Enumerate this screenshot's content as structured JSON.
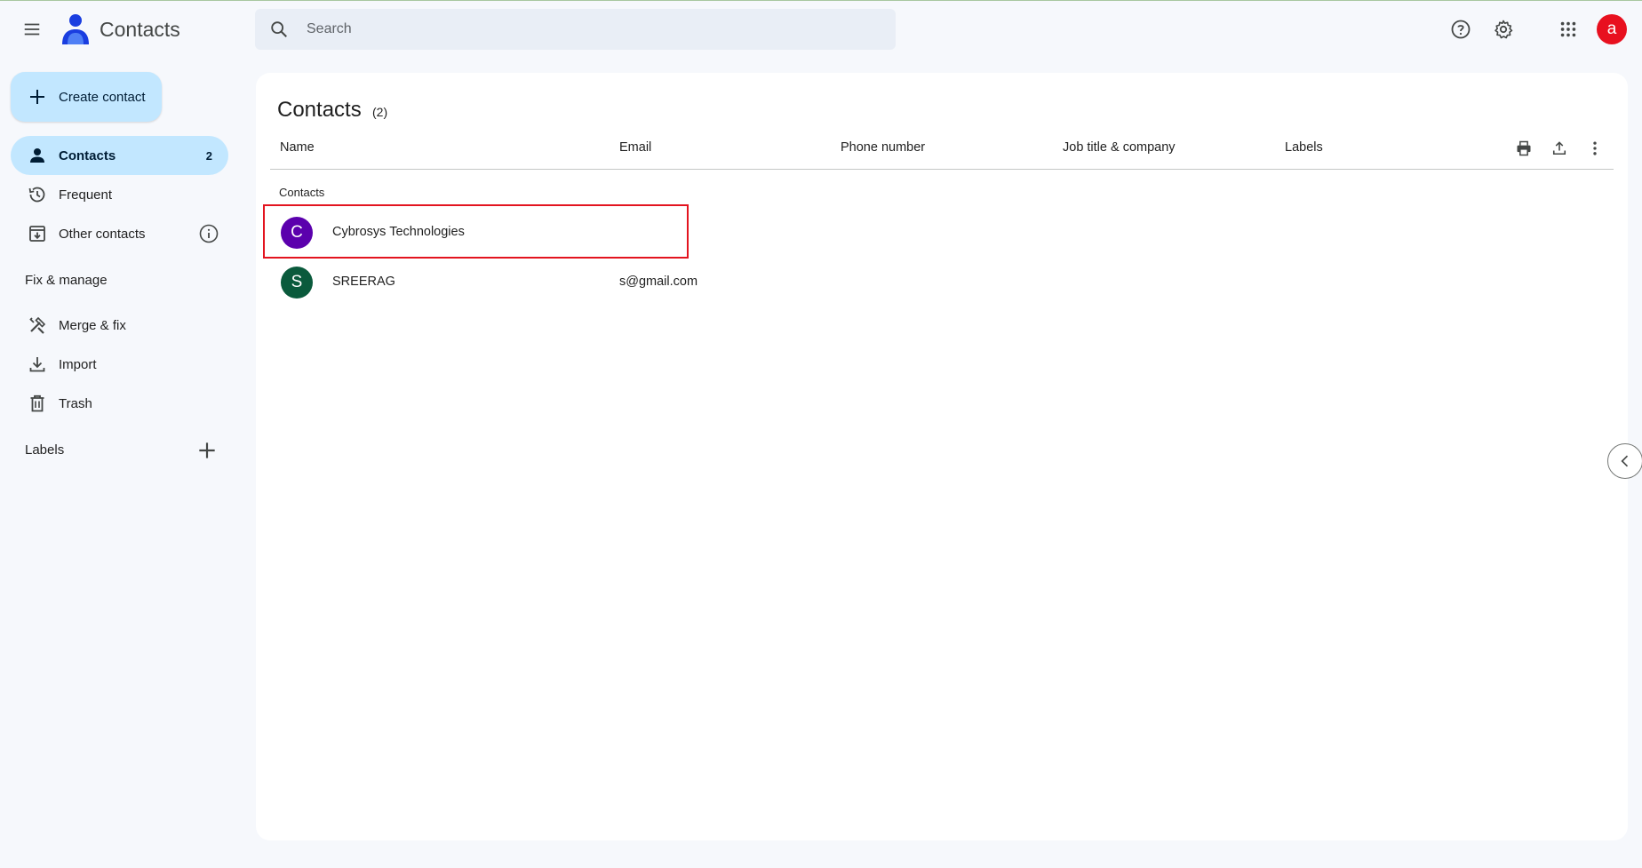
{
  "header": {
    "app_title": "Contacts",
    "search_placeholder": "Search",
    "avatar_letter": "a",
    "avatar_color": "#e8101f"
  },
  "sidebar": {
    "create_label": "Create contact",
    "nav": [
      {
        "label": "Contacts",
        "count": "2",
        "icon": "person-icon",
        "active": true
      },
      {
        "label": "Frequent",
        "icon": "history-icon"
      },
      {
        "label": "Other contacts",
        "icon": "archive-download-icon"
      }
    ],
    "fix_manage_title": "Fix & manage",
    "fix_items": [
      {
        "label": "Merge & fix",
        "icon": "merge-fix-icon"
      },
      {
        "label": "Import",
        "icon": "download-icon"
      },
      {
        "label": "Trash",
        "icon": "trash-icon"
      }
    ],
    "labels_title": "Labels"
  },
  "main": {
    "title": "Contacts",
    "count": "(2)",
    "columns": [
      "Name",
      "Email",
      "Phone number",
      "Job title & company",
      "Labels"
    ],
    "group_label": "Contacts",
    "rows": [
      {
        "initial": "C",
        "name": "Cybrosys Technologies",
        "email": "",
        "avatar_color": "#5b00ad"
      },
      {
        "initial": "S",
        "name": "SREERAG",
        "email": "s@gmail.com",
        "avatar_color": "#0a5a3c"
      }
    ]
  },
  "colors": {
    "accent": "#c2e7ff",
    "background": "#f6f8fc",
    "highlight": "#e3141f"
  }
}
